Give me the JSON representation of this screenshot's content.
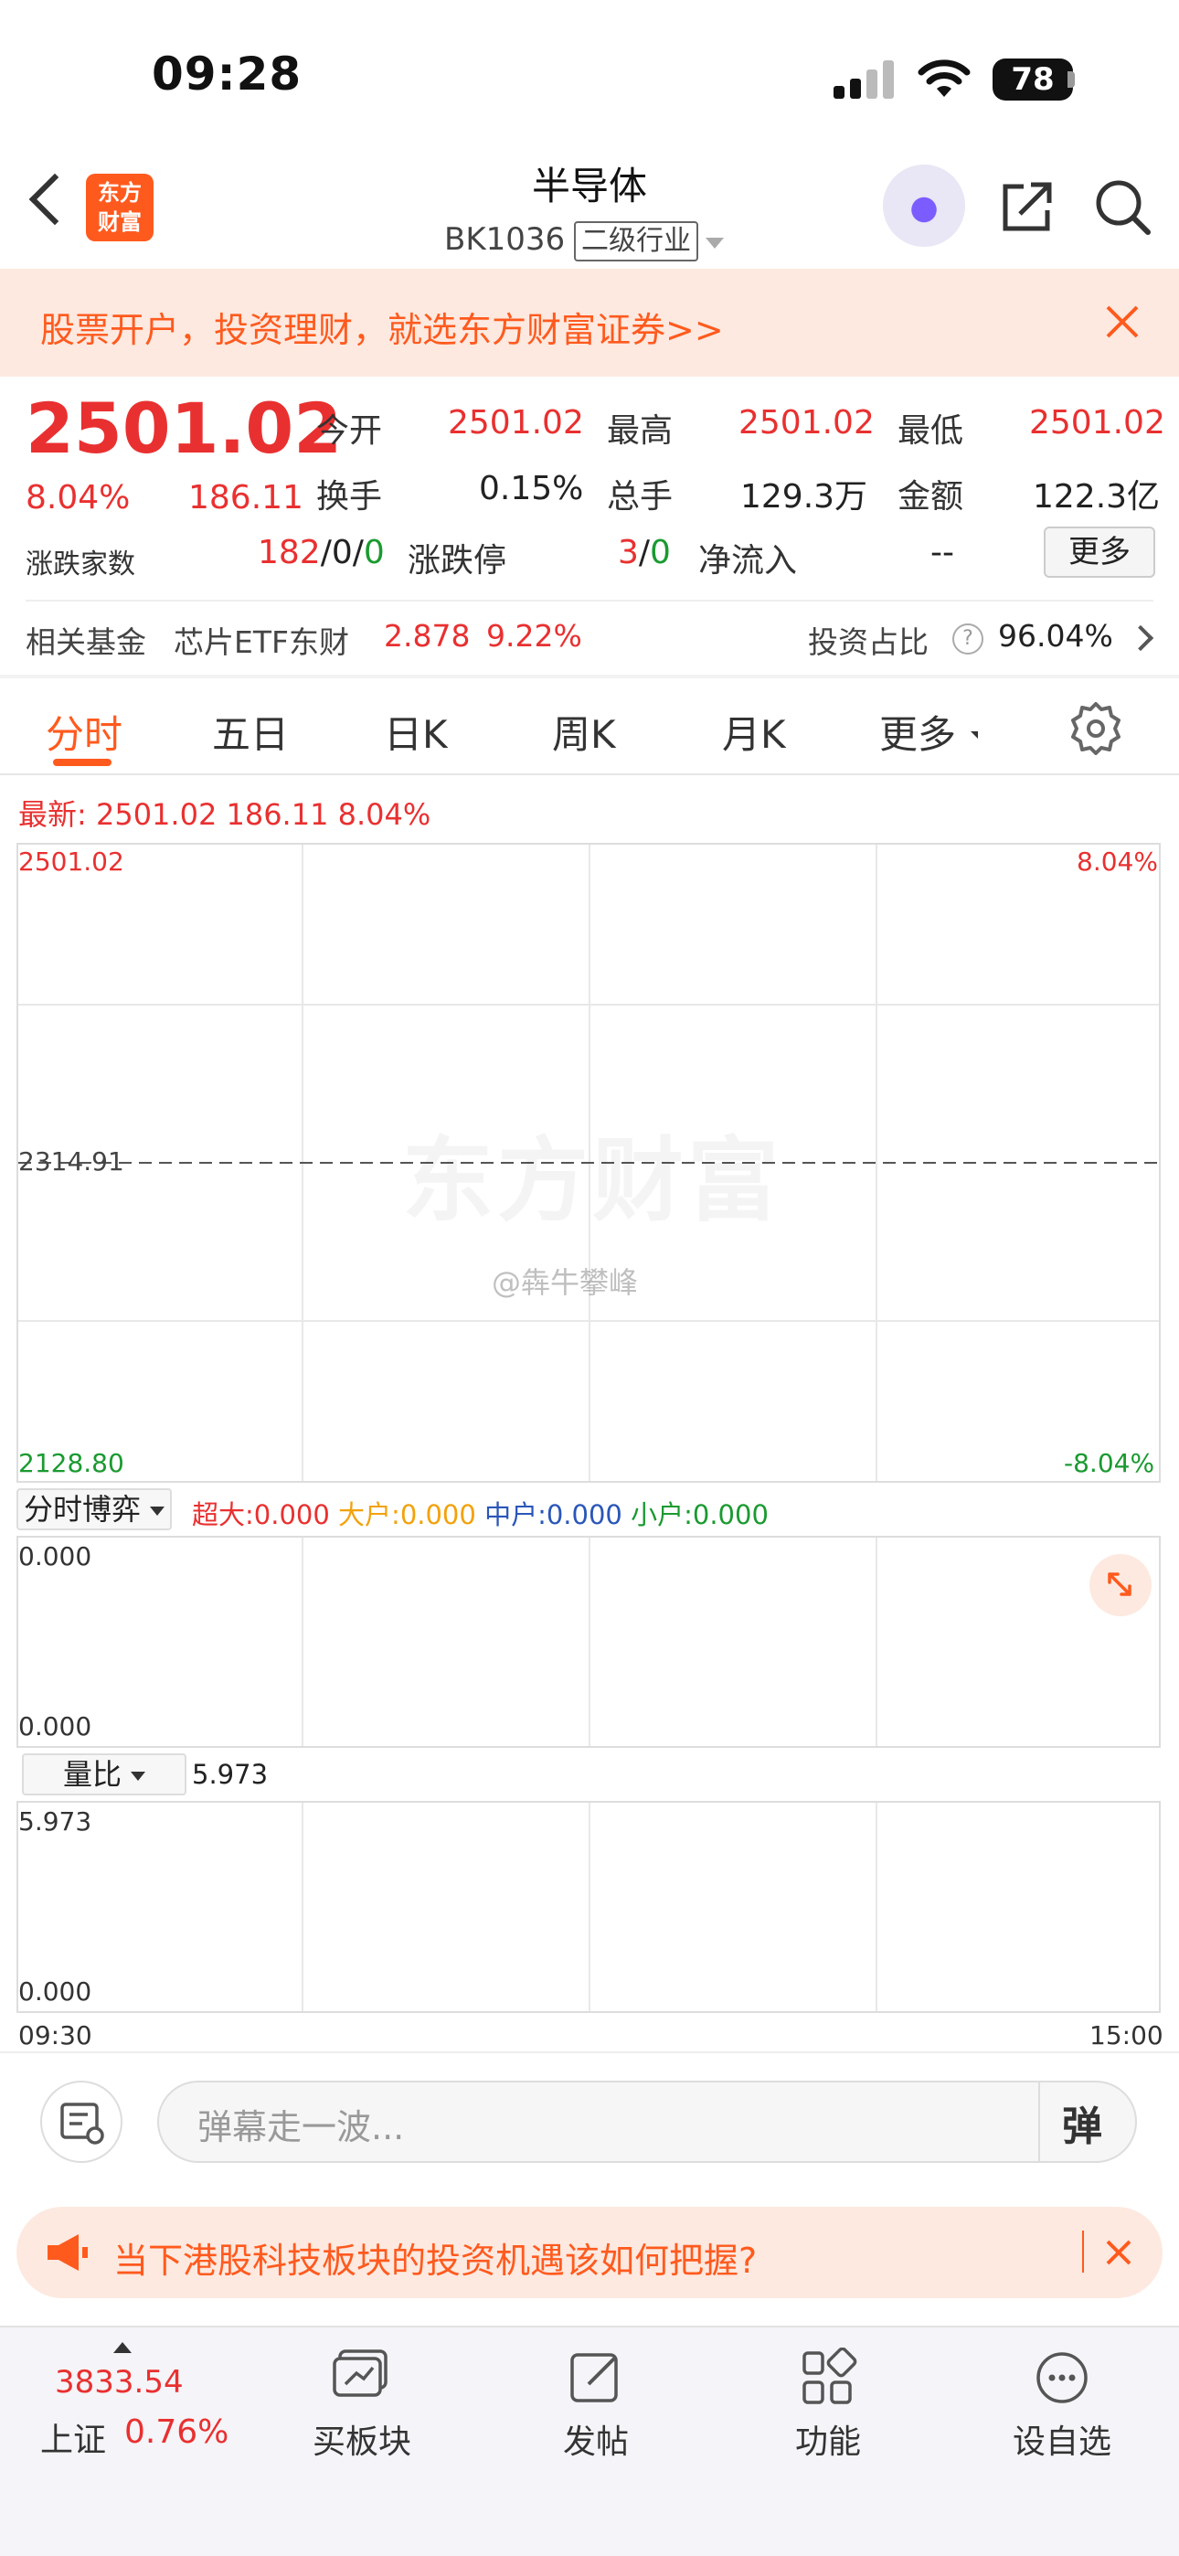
{
  "status": {
    "time": "09:28",
    "battery": "78"
  },
  "header": {
    "title": "半导体",
    "code": "BK1036",
    "tag": "二级行业",
    "logo_line1": "东方",
    "logo_line2": "财富"
  },
  "banner": {
    "text": "股票开户，投资理财，就选东方财富证券>>"
  },
  "quote": {
    "price": "2501.02",
    "change_pct": "8.04%",
    "change": "186.11",
    "open_label": "今开",
    "open": "2501.02",
    "high_label": "最高",
    "high": "2501.02",
    "low_label": "最低",
    "low": "2501.02",
    "turnover_label": "换手",
    "turnover": "0.15%",
    "volume_label": "总手",
    "volume": "129.3万",
    "amount_label": "金额",
    "amount": "122.3亿",
    "breadth_label": "涨跌家数",
    "breadth_up": "182",
    "breadth_flat": "0",
    "breadth_down": "0",
    "slash": "/",
    "limit_label": "涨跌停",
    "limit_up": "3",
    "limit_down": "0",
    "inflow_label": "净流入",
    "inflow": "--",
    "more_button": "更多"
  },
  "fund": {
    "label": "相关基金",
    "name": "芯片ETF东财",
    "price": "2.878",
    "pct": "9.22%",
    "ratio_label": "投资占比",
    "ratio": "96.04%"
  },
  "tabs": [
    "分时",
    "五日",
    "日K",
    "周K",
    "月K",
    "更多"
  ],
  "chart": {
    "latest_label": "最新:",
    "latest_price": "2501.02",
    "latest_change": "186.11",
    "latest_pct": "8.04%",
    "y_top": "2501.02",
    "y_mid": "2314.91",
    "y_bottom": "2128.80",
    "pct_top": "8.04%",
    "pct_bottom": "-8.04%",
    "watermark": "东方财富",
    "weibo_mark": "@犇牛攀峰"
  },
  "game_panel": {
    "select_label": "分时博弈",
    "xl_label": "超大:",
    "xl_value": "0.000",
    "l_label": "大户:",
    "l_value": "0.000",
    "m_label": "中户:",
    "m_value": "0.000",
    "s_label": "小户:",
    "s_value": "0.000",
    "y_top": "0.000",
    "y_bottom": "0.000"
  },
  "volume_ratio": {
    "select_label": "量比",
    "value": "5.973",
    "y_top": "5.973",
    "y_bottom": "0.000",
    "time_start": "09:30",
    "time_end": "15:00"
  },
  "danmaku": {
    "placeholder": "弹幕走一波...",
    "button": "弹"
  },
  "news": {
    "text": "当下港股科技板块的投资机遇该如何把握?"
  },
  "bottom_nav": {
    "index_value": "3833.54",
    "index_name": "上证",
    "index_pct": "0.76%",
    "items": [
      "买板块",
      "发帖",
      "功能",
      "设自选"
    ]
  },
  "colors": {
    "up": "#e93030",
    "down": "#1a9a30",
    "accent": "#ff5a1e"
  }
}
